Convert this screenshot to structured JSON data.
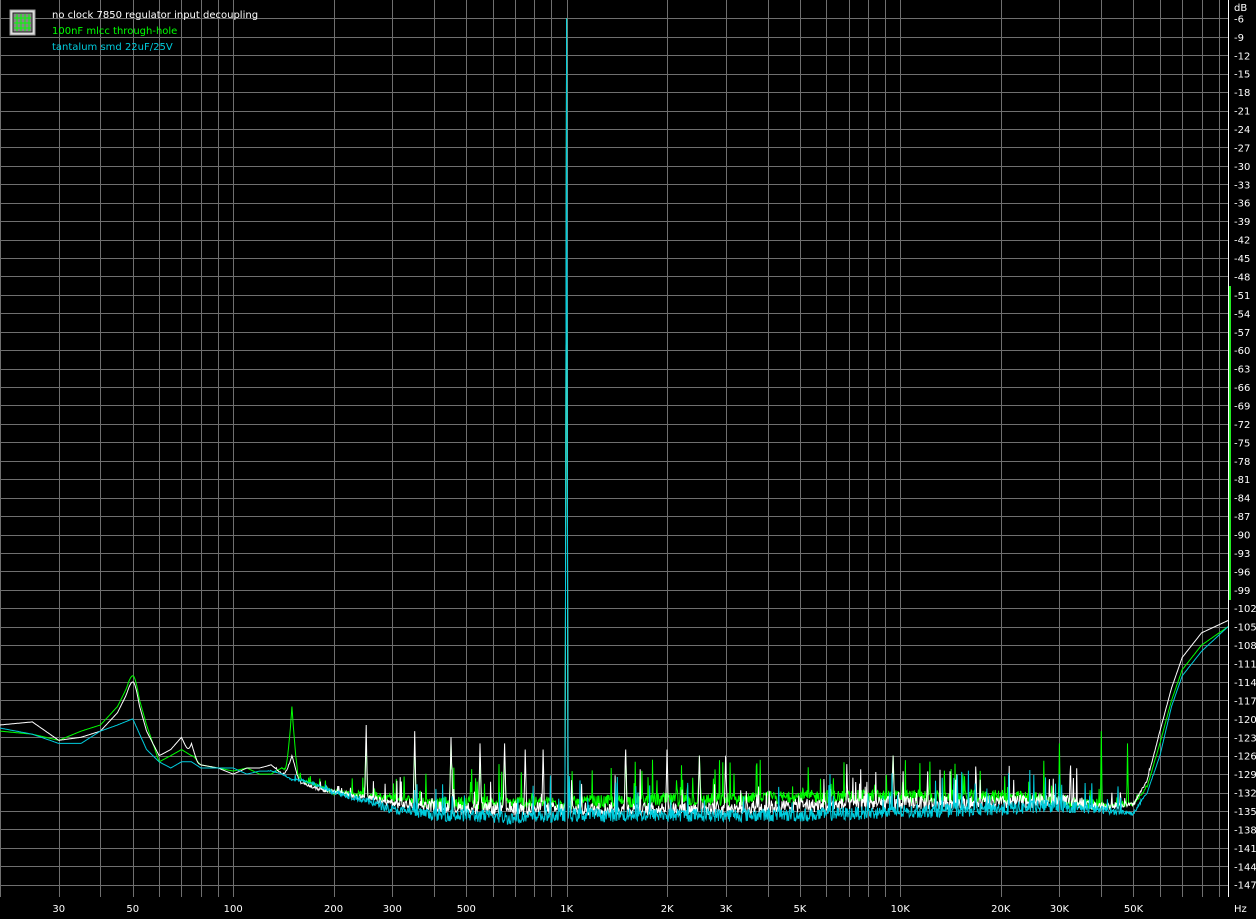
{
  "chart_data": {
    "type": "line",
    "title": "",
    "xlabel": "",
    "ylabel": "",
    "x_unit": "Hz",
    "y_unit": "dB",
    "x_scale": "log",
    "xlim": [
      20,
      96000
    ],
    "ylim": [
      -149,
      -3
    ],
    "grid": true,
    "legend_position": "top-left",
    "x_ticks": [
      {
        "value": 30,
        "label": "30"
      },
      {
        "value": 50,
        "label": "50"
      },
      {
        "value": 100,
        "label": "100"
      },
      {
        "value": 200,
        "label": "200"
      },
      {
        "value": 300,
        "label": "300"
      },
      {
        "value": 500,
        "label": "500"
      },
      {
        "value": 1000,
        "label": "1K"
      },
      {
        "value": 2000,
        "label": "2K"
      },
      {
        "value": 3000,
        "label": "3K"
      },
      {
        "value": 5000,
        "label": "5K"
      },
      {
        "value": 10000,
        "label": "10K"
      },
      {
        "value": 20000,
        "label": "20K"
      },
      {
        "value": 30000,
        "label": "30K"
      },
      {
        "value": 50000,
        "label": "50K"
      }
    ],
    "y_ticks": [
      -6,
      -9,
      -12,
      -15,
      -18,
      -21,
      -24,
      -27,
      -30,
      -33,
      -36,
      -39,
      -42,
      -45,
      -48,
      -51,
      -54,
      -57,
      -60,
      -63,
      -66,
      -69,
      -72,
      -75,
      -78,
      -81,
      -84,
      -87,
      -90,
      -93,
      -96,
      -99,
      -102,
      -105,
      -108,
      -111,
      -114,
      -117,
      -120,
      -123,
      -126,
      -129,
      -132,
      -135,
      -138,
      -141,
      -144,
      -147
    ],
    "y_tick_label_overrides": {
      "-63": "-63",
      "-66": "-66"
    },
    "series": [
      {
        "name": "no clock 7850 regulator input decoupling",
        "color": "#ffffff",
        "points": [
          [
            20,
            -121
          ],
          [
            25,
            -120.5
          ],
          [
            30,
            -123.5
          ],
          [
            35,
            -123
          ],
          [
            40,
            -122
          ],
          [
            45,
            -119
          ],
          [
            50,
            -114
          ],
          [
            55,
            -122
          ],
          [
            60,
            -126
          ],
          [
            65,
            -125
          ],
          [
            70,
            -123
          ],
          [
            75,
            -126.5
          ],
          [
            80,
            -127.5
          ],
          [
            90,
            -128
          ],
          [
            100,
            -129
          ],
          [
            110,
            -128
          ],
          [
            120,
            -128
          ],
          [
            130,
            -127.5
          ],
          [
            140,
            -129
          ],
          [
            150,
            -128.5
          ],
          [
            160,
            -130.5
          ],
          [
            180,
            -131.5
          ],
          [
            200,
            -132
          ],
          [
            250,
            -133
          ],
          [
            300,
            -134
          ],
          [
            400,
            -134.5
          ],
          [
            500,
            -135
          ],
          [
            700,
            -135
          ],
          [
            1000,
            -135
          ],
          [
            2000,
            -135
          ],
          [
            3000,
            -135
          ],
          [
            5000,
            -134.5
          ],
          [
            10000,
            -134
          ],
          [
            20000,
            -134
          ],
          [
            30000,
            -133.5
          ],
          [
            40000,
            -134.5
          ],
          [
            50000,
            -134
          ],
          [
            55000,
            -130
          ],
          [
            60000,
            -122
          ],
          [
            65000,
            -115
          ],
          [
            70000,
            -110
          ],
          [
            80000,
            -106
          ],
          [
            96000,
            -104
          ]
        ],
        "peaks": [
          [
            50,
            -114
          ],
          [
            75,
            -124
          ],
          [
            150,
            -126
          ],
          [
            250,
            -121
          ],
          [
            350,
            -122
          ],
          [
            450,
            -123
          ],
          [
            550,
            -124
          ],
          [
            650,
            -124
          ],
          [
            750,
            -125
          ],
          [
            850,
            -125
          ],
          [
            1000,
            -6
          ],
          [
            1500,
            -125
          ],
          [
            2000,
            -125
          ],
          [
            2500,
            -126
          ],
          [
            3000,
            -126
          ],
          [
            9500,
            -126
          ]
        ]
      },
      {
        "name": "100nF mlcc through-hole",
        "color": "#00ff00",
        "points": [
          [
            20,
            -122
          ],
          [
            25,
            -122.5
          ],
          [
            30,
            -123.5
          ],
          [
            35,
            -122
          ],
          [
            40,
            -121
          ],
          [
            45,
            -118
          ],
          [
            50,
            -113
          ],
          [
            55,
            -121
          ],
          [
            60,
            -127
          ],
          [
            65,
            -126
          ],
          [
            70,
            -125
          ],
          [
            75,
            -126
          ],
          [
            80,
            -127.5
          ],
          [
            90,
            -128
          ],
          [
            100,
            -128.5
          ],
          [
            110,
            -128
          ],
          [
            120,
            -129
          ],
          [
            130,
            -129
          ],
          [
            140,
            -128
          ],
          [
            150,
            -129
          ],
          [
            160,
            -130
          ],
          [
            180,
            -131
          ],
          [
            200,
            -132
          ],
          [
            250,
            -132.5
          ],
          [
            300,
            -133
          ],
          [
            400,
            -134
          ],
          [
            500,
            -134
          ],
          [
            700,
            -134
          ],
          [
            1000,
            -134
          ],
          [
            2000,
            -133.5
          ],
          [
            3000,
            -133.5
          ],
          [
            5000,
            -133
          ],
          [
            10000,
            -133
          ],
          [
            20000,
            -133
          ],
          [
            30000,
            -133.5
          ],
          [
            40000,
            -134.5
          ],
          [
            50000,
            -134
          ],
          [
            55000,
            -131
          ],
          [
            60000,
            -124
          ],
          [
            65000,
            -117
          ],
          [
            70000,
            -112
          ],
          [
            80000,
            -108
          ],
          [
            96000,
            -105
          ]
        ],
        "peaks": [
          [
            50,
            -113
          ],
          [
            75,
            -126
          ],
          [
            150,
            -118
          ],
          [
            250,
            -124
          ],
          [
            350,
            -124
          ],
          [
            450,
            -124
          ],
          [
            550,
            -126
          ],
          [
            650,
            -126
          ],
          [
            1000,
            -6
          ],
          [
            1500,
            -126
          ],
          [
            2500,
            -126
          ],
          [
            9500,
            -126
          ],
          [
            30000,
            -124
          ],
          [
            40000,
            -122
          ],
          [
            48000,
            -124
          ],
          [
            70000,
            -112
          ]
        ]
      },
      {
        "name": "tantalum smd 22uF/25V",
        "color": "#00ccdd",
        "points": [
          [
            20,
            -121.5
          ],
          [
            25,
            -122.5
          ],
          [
            30,
            -124
          ],
          [
            35,
            -124
          ],
          [
            40,
            -122
          ],
          [
            45,
            -121
          ],
          [
            50,
            -120
          ],
          [
            55,
            -125
          ],
          [
            60,
            -127
          ],
          [
            65,
            -128
          ],
          [
            70,
            -127
          ],
          [
            75,
            -127
          ],
          [
            80,
            -128
          ],
          [
            90,
            -128
          ],
          [
            100,
            -128
          ],
          [
            110,
            -129
          ],
          [
            120,
            -128.5
          ],
          [
            130,
            -128.5
          ],
          [
            140,
            -129
          ],
          [
            150,
            -130
          ],
          [
            160,
            -130
          ],
          [
            180,
            -131
          ],
          [
            200,
            -132
          ],
          [
            250,
            -133.5
          ],
          [
            300,
            -135
          ],
          [
            400,
            -136
          ],
          [
            500,
            -136
          ],
          [
            700,
            -136.5
          ],
          [
            1000,
            -136
          ],
          [
            2000,
            -136
          ],
          [
            3000,
            -136
          ],
          [
            5000,
            -136
          ],
          [
            10000,
            -135.5
          ],
          [
            20000,
            -135
          ],
          [
            30000,
            -134.5
          ],
          [
            40000,
            -135
          ],
          [
            50000,
            -135.5
          ],
          [
            55000,
            -132
          ],
          [
            60000,
            -126
          ],
          [
            65000,
            -118
          ],
          [
            70000,
            -113
          ],
          [
            80000,
            -109
          ],
          [
            96000,
            -105
          ]
        ],
        "peaks": [
          [
            1000,
            -6
          ],
          [
            30000,
            -129
          ],
          [
            45000,
            -131
          ]
        ]
      }
    ]
  }
}
